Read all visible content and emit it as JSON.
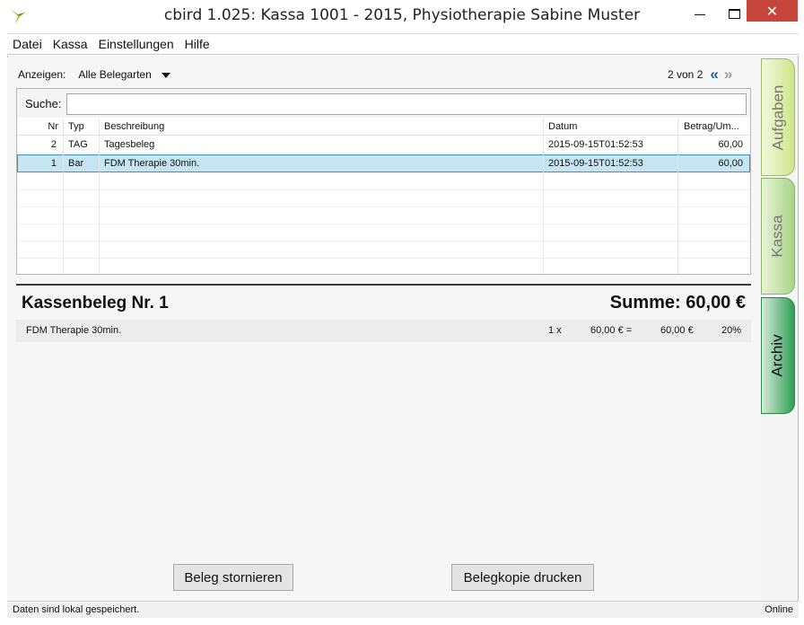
{
  "window": {
    "title": "cbird 1.025: Kassa 1001 - 2015, Physiotherapie Sabine Muster",
    "close_glyph": "✕"
  },
  "menu": [
    "Datei",
    "Kassa",
    "Einstellungen",
    "Hilfe"
  ],
  "filter": {
    "label": "Anzeigen:",
    "value": "Alle Belegarten"
  },
  "pager": {
    "text": "2 von 2",
    "prev_glyph": "«",
    "next_glyph": "»"
  },
  "search": {
    "label": "Suche:",
    "value": ""
  },
  "table": {
    "columns": [
      "Nr",
      "Typ",
      "Beschreibung",
      "Datum",
      "Betrag/Um..."
    ],
    "rows": [
      {
        "nr": "2",
        "typ": "TAG",
        "beschreibung": "Tagesbeleg",
        "datum": "2015-09-15T01:52:53",
        "betrag": "60,00"
      },
      {
        "nr": "1",
        "typ": "Bar",
        "beschreibung": "FDM Therapie 30min.",
        "datum": "2015-09-15T01:52:53",
        "betrag": "60,00"
      }
    ]
  },
  "receipt": {
    "title": "Kassenbeleg Nr. 1",
    "sum": "Summe: 60,00 €",
    "items": [
      {
        "name": "FDM Therapie 30min.",
        "qty": "1 x",
        "price": "60,00 € =",
        "total": "60,00 €",
        "tax": "20%"
      }
    ]
  },
  "buttons": {
    "cancel_label": "Beleg stornieren",
    "print_copy_label": "Belegkopie drucken"
  },
  "status": {
    "left": "Daten sind lokal gespeichert.",
    "right": "Online"
  },
  "side_tabs": [
    "Aufgaben",
    "Kassa",
    "Archiv"
  ]
}
